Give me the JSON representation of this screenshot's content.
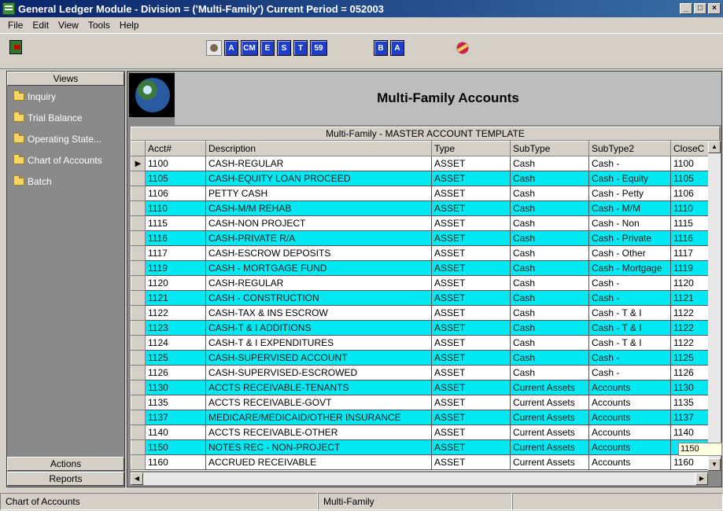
{
  "window": {
    "title": "General Ledger Module - Division = ('Multi-Family') Current Period = 052003",
    "controls": [
      "_",
      "□",
      "×"
    ]
  },
  "menu": [
    "File",
    "Edit",
    "View",
    "Tools",
    "Help"
  ],
  "toolbar": {
    "group1": [
      "A",
      "CM",
      "E",
      "S",
      "T",
      "59"
    ],
    "group2": [
      "B",
      "A"
    ]
  },
  "sidebar": {
    "header": "Views",
    "items": [
      "Inquiry",
      "Trial Balance",
      "Operating State...",
      "Chart of Accounts",
      "Batch"
    ],
    "footer_actions": "Actions",
    "footer_reports": "Reports"
  },
  "page": {
    "title": "Multi-Family Accounts",
    "grid_caption": "Multi-Family - MASTER ACCOUNT TEMPLATE"
  },
  "table": {
    "columns": [
      "Acct#",
      "Description",
      "Type",
      "SubType",
      "SubType2",
      "CloseC"
    ],
    "rows": [
      {
        "acct": "1100",
        "desc": "CASH-REGULAR",
        "type": "ASSET",
        "subtype": "Cash",
        "subtype2": "Cash -",
        "close": "1100",
        "color": "white",
        "selected": true
      },
      {
        "acct": "1105",
        "desc": "CASH-EQUITY LOAN PROCEED",
        "type": "ASSET",
        "subtype": "Cash",
        "subtype2": "Cash - Equity",
        "close": "1105",
        "color": "cyan"
      },
      {
        "acct": "1106",
        "desc": "PETTY CASH",
        "type": "ASSET",
        "subtype": "Cash",
        "subtype2": "Cash - Petty",
        "close": "1106",
        "color": "white"
      },
      {
        "acct": "1110",
        "desc": "CASH-M/M REHAB",
        "type": "ASSET",
        "subtype": "Cash",
        "subtype2": "Cash - M/M",
        "close": "1110",
        "color": "cyan"
      },
      {
        "acct": "1115",
        "desc": "CASH-NON PROJECT",
        "type": "ASSET",
        "subtype": "Cash",
        "subtype2": "Cash - Non",
        "close": "1115",
        "color": "white"
      },
      {
        "acct": "1116",
        "desc": "CASH-PRIVATE R/A",
        "type": "ASSET",
        "subtype": "Cash",
        "subtype2": "Cash - Private",
        "close": "1116",
        "color": "cyan"
      },
      {
        "acct": "1117",
        "desc": "CASH-ESCROW DEPOSITS",
        "type": "ASSET",
        "subtype": "Cash",
        "subtype2": "Cash - Other",
        "close": "1117",
        "color": "white"
      },
      {
        "acct": "1119",
        "desc": "CASH - MORTGAGE FUND",
        "type": "ASSET",
        "subtype": "Cash",
        "subtype2": "Cash - Mortgage",
        "close": "1119",
        "color": "cyan"
      },
      {
        "acct": "1120",
        "desc": "CASH-REGULAR",
        "type": "ASSET",
        "subtype": "Cash",
        "subtype2": "Cash -",
        "close": "1120",
        "color": "white"
      },
      {
        "acct": "1121",
        "desc": "CASH - CONSTRUCTION",
        "type": "ASSET",
        "subtype": "Cash",
        "subtype2": "Cash -",
        "close": "1121",
        "color": "cyan"
      },
      {
        "acct": "1122",
        "desc": "CASH-TAX & INS ESCROW",
        "type": "ASSET",
        "subtype": "Cash",
        "subtype2": "Cash - T & I",
        "close": "1122",
        "color": "white"
      },
      {
        "acct": "1123",
        "desc": "CASH-T & I ADDITIONS",
        "type": "ASSET",
        "subtype": "Cash",
        "subtype2": "Cash - T & I",
        "close": "1122",
        "color": "cyan"
      },
      {
        "acct": "1124",
        "desc": "CASH-T & I EXPENDITURES",
        "type": "ASSET",
        "subtype": "Cash",
        "subtype2": "Cash - T & I",
        "close": "1122",
        "color": "white"
      },
      {
        "acct": "1125",
        "desc": "CASH-SUPERVISED ACCOUNT",
        "type": "ASSET",
        "subtype": "Cash",
        "subtype2": "Cash -",
        "close": "1125",
        "color": "cyan"
      },
      {
        "acct": "1126",
        "desc": "CASH-SUPERVISED-ESCROWED",
        "type": "ASSET",
        "subtype": "Cash",
        "subtype2": "Cash -",
        "close": "1126",
        "color": "white"
      },
      {
        "acct": "1130",
        "desc": "ACCTS RECEIVABLE-TENANTS",
        "type": "ASSET",
        "subtype": "Current Assets",
        "subtype2": "Accounts",
        "close": "1130",
        "color": "cyan"
      },
      {
        "acct": "1135",
        "desc": "ACCTS RECEIVABLE-GOVT",
        "type": "ASSET",
        "subtype": "Current Assets",
        "subtype2": "Accounts",
        "close": "1135",
        "color": "white"
      },
      {
        "acct": "1137",
        "desc": "MEDICARE/MEDICAID/OTHER INSURANCE",
        "type": "ASSET",
        "subtype": "Current Assets",
        "subtype2": "Accounts",
        "close": "1137",
        "color": "cyan"
      },
      {
        "acct": "1140",
        "desc": "ACCTS RECEIVABLE-OTHER",
        "type": "ASSET",
        "subtype": "Current Assets",
        "subtype2": "Accounts",
        "close": "1140",
        "color": "white"
      },
      {
        "acct": "1150",
        "desc": "NOTES REC - NON-PROJECT",
        "type": "ASSET",
        "subtype": "Current Assets",
        "subtype2": "Accounts",
        "close": "",
        "color": "cyan"
      },
      {
        "acct": "1160",
        "desc": "ACCRUED RECEIVABLE",
        "type": "ASSET",
        "subtype": "Current Assets",
        "subtype2": "Accounts",
        "close": "1160",
        "color": "white"
      }
    ]
  },
  "tooltip": "1150",
  "status": [
    "Chart of Accounts",
    "Multi-Family",
    ""
  ],
  "colors": {
    "row_highlight": "#00e8f2",
    "title_bar": "#0a246a",
    "panel_gray": "#8a8a8a"
  }
}
